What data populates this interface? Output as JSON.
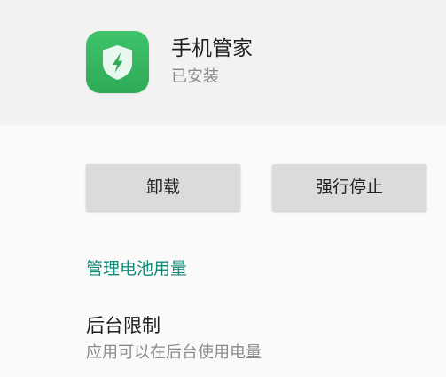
{
  "app": {
    "name": "手机管家",
    "status": "已安装",
    "icon": "shield-lightning-icon",
    "icon_color": "#34b65c"
  },
  "actions": {
    "uninstall_label": "卸载",
    "force_stop_label": "强行停止"
  },
  "battery": {
    "manage_link": "管理电池用量",
    "link_color": "#138a78",
    "background_restriction": {
      "title": "后台限制",
      "summary": "应用可以在后台使用电量"
    }
  }
}
